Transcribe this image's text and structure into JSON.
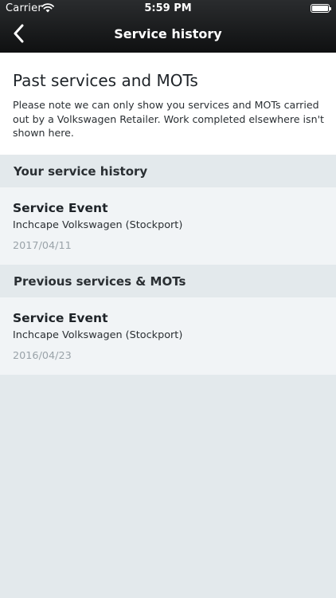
{
  "status_bar": {
    "carrier": "Carrier",
    "time": "5:59 PM"
  },
  "nav": {
    "title": "Service history",
    "back_icon": "chevron-left-icon"
  },
  "intro": {
    "title": "Past services and MOTs",
    "text": "Please note we can only show you services and MOTs carried out by a Volkswagen Retailer. Work completed elsewhere isn't shown here."
  },
  "sections": [
    {
      "header": "Your service history",
      "events": [
        {
          "title": "Service Event",
          "retailer": "Inchcape Volkswagen (Stockport)",
          "date": "2017/04/11"
        }
      ]
    },
    {
      "header": "Previous services & MOTs",
      "events": [
        {
          "title": "Service Event",
          "retailer": "Inchcape Volkswagen (Stockport)",
          "date": "2016/04/23"
        }
      ]
    }
  ],
  "colors": {
    "header_background": "#1b1c1e",
    "page_background": "#e3e9ec",
    "card_background": "#f1f4f6",
    "date_text": "#9aa3a9"
  }
}
